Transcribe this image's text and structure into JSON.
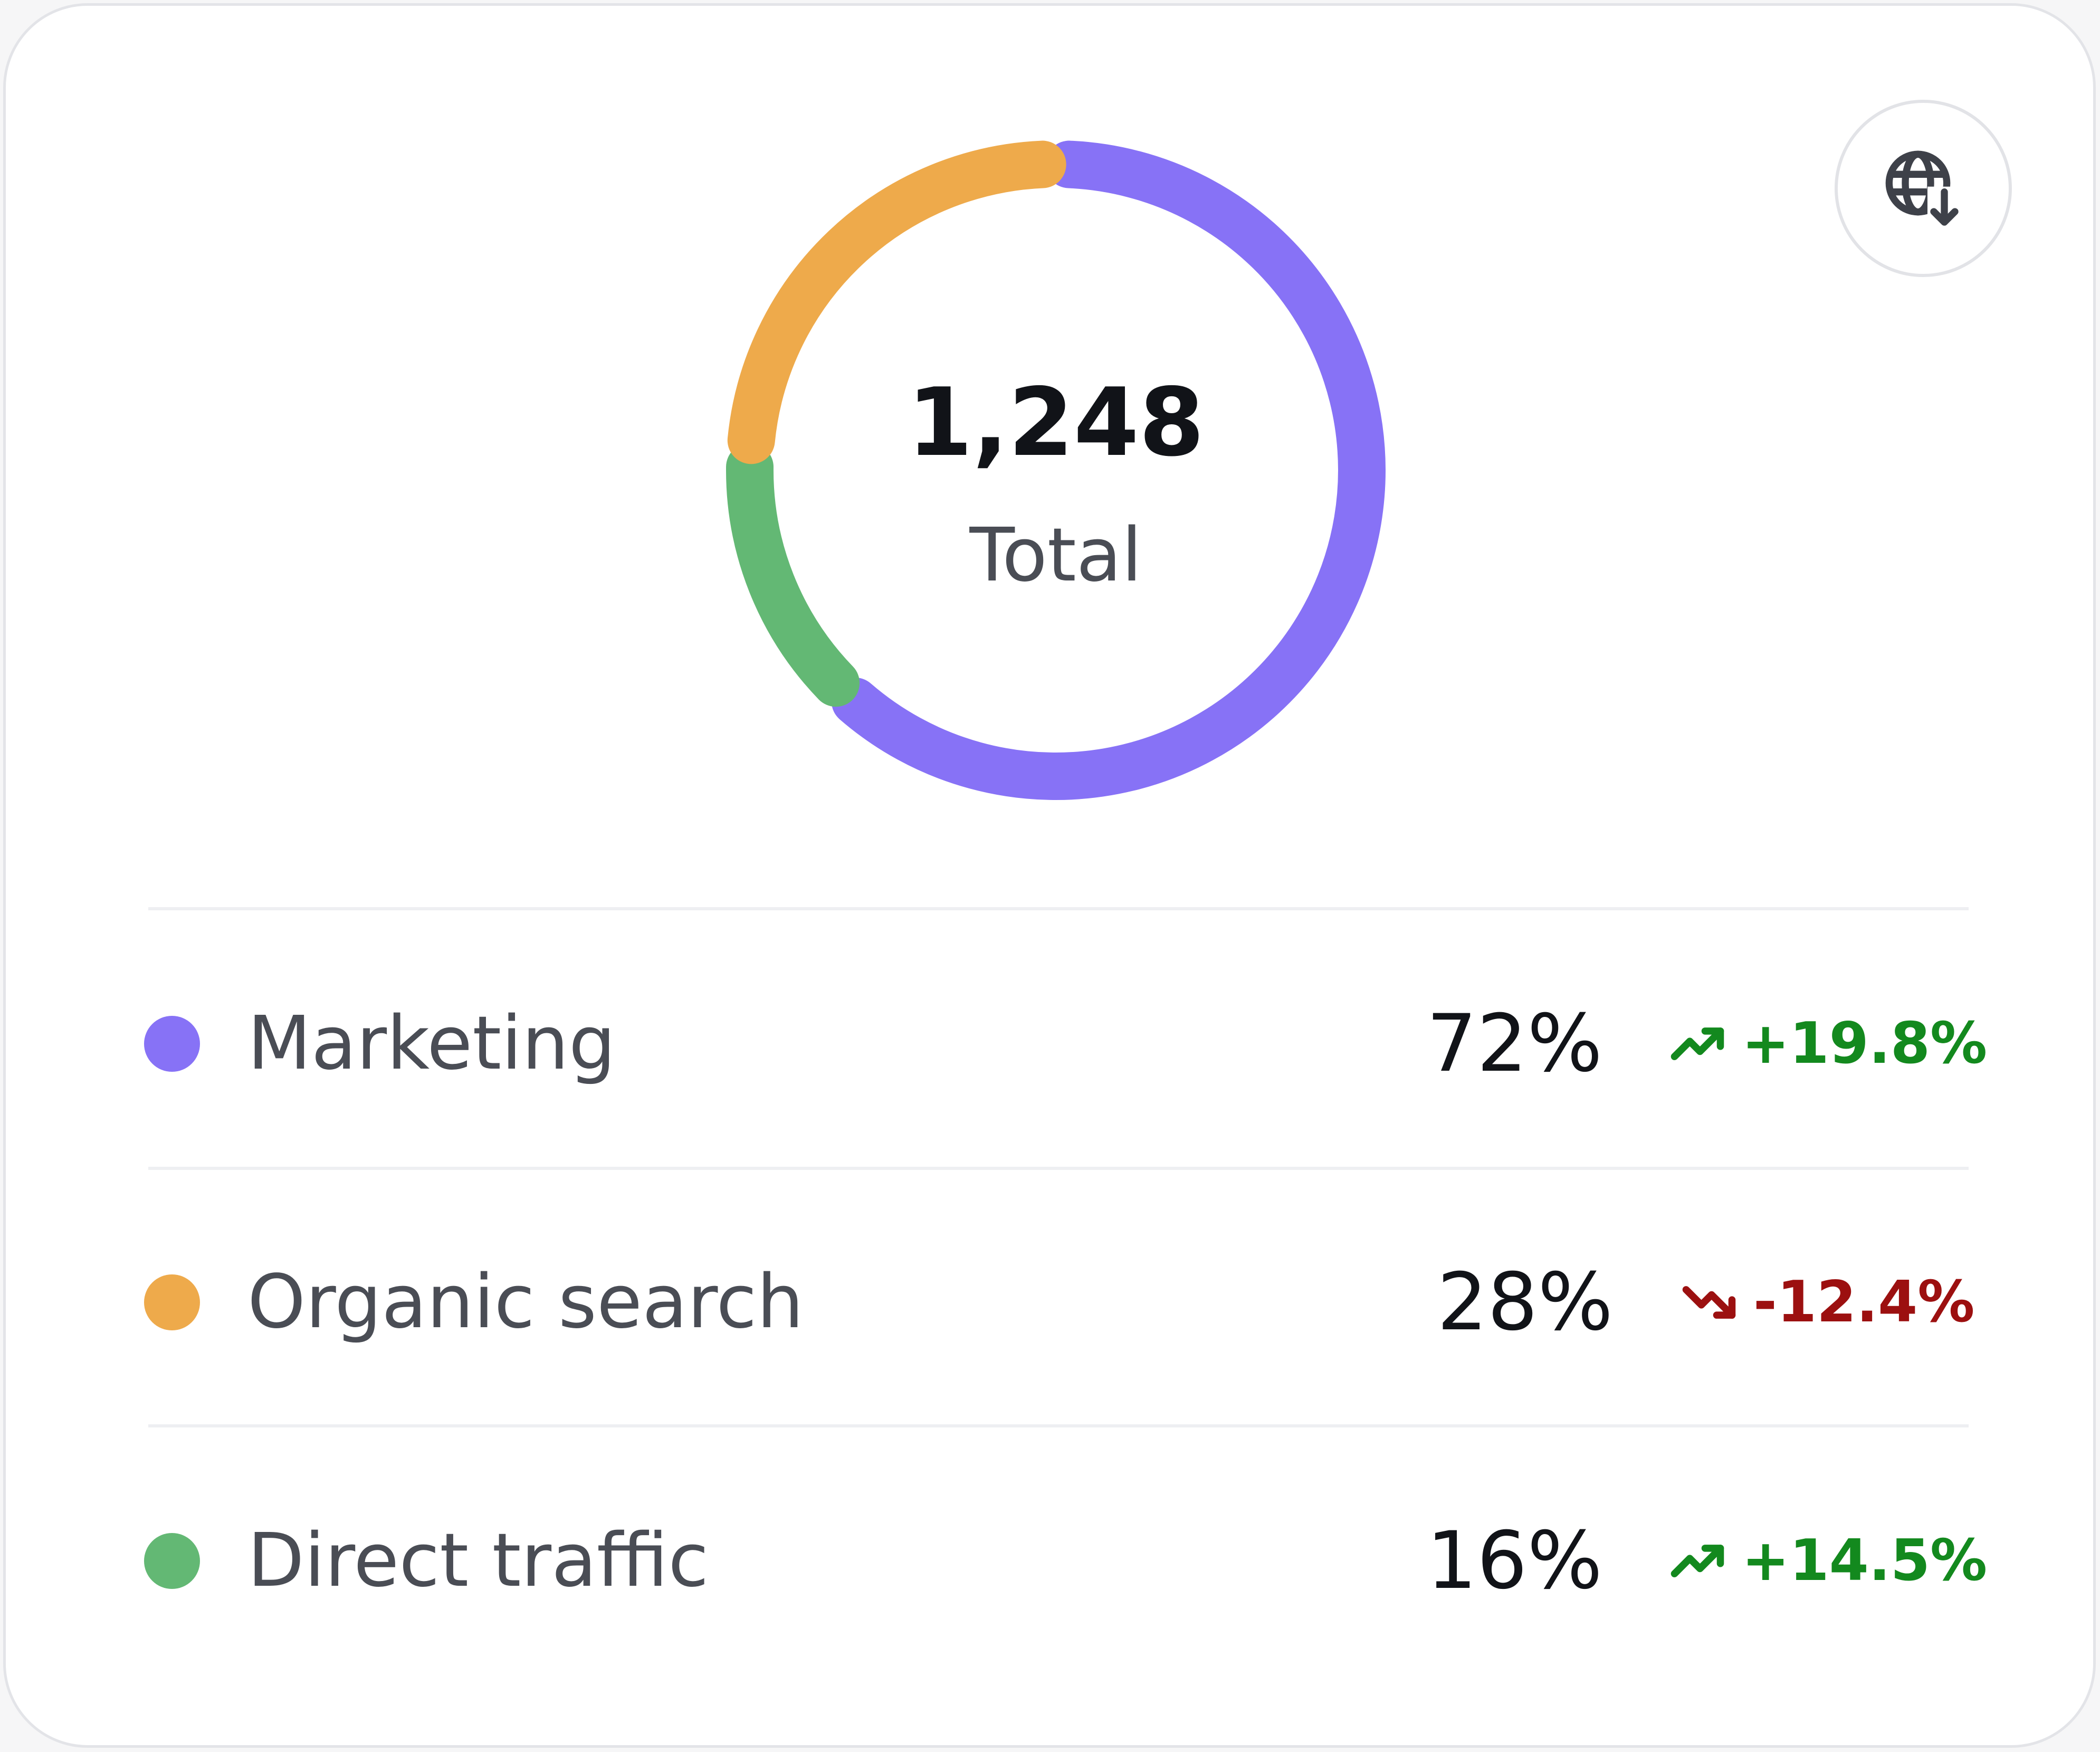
{
  "summary": {
    "total": "1,248",
    "label": "Total"
  },
  "actions": {
    "globe_icon": "globe-download-icon"
  },
  "colors": {
    "marketing": "#8772f6",
    "organic": "#eeaa4b",
    "direct": "#63b874",
    "positive": "#13891e",
    "negative": "#9c1010"
  },
  "chart_data": {
    "type": "pie",
    "categories": [
      "Marketing",
      "Organic search",
      "Direct traffic"
    ],
    "values": [
      72,
      28,
      16
    ],
    "unit": "%"
  },
  "legend": [
    {
      "label": "Marketing",
      "percent": "72%",
      "change": "+19.8%",
      "trend": "up",
      "color": "#8772f6"
    },
    {
      "label": "Organic search",
      "percent": "28%",
      "change": "-12.4%",
      "trend": "down",
      "color": "#eeaa4b"
    },
    {
      "label": "Direct traffic",
      "percent": "16%",
      "change": "+14.5%",
      "trend": "up",
      "color": "#63b874"
    }
  ]
}
